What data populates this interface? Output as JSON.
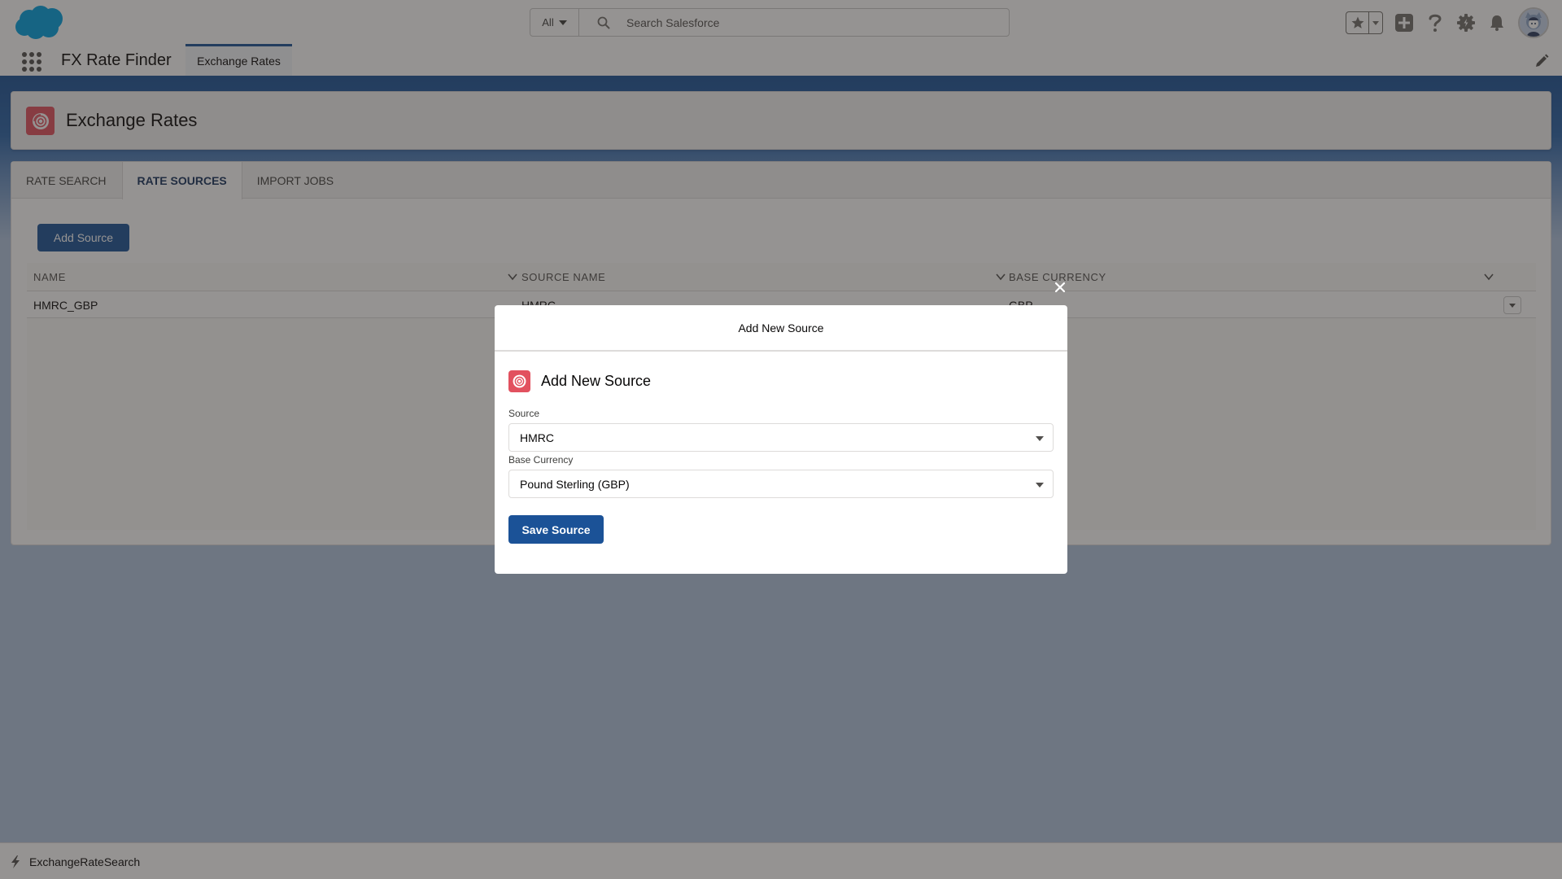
{
  "global_header": {
    "search_scope": "All",
    "search_placeholder": "Search Salesforce",
    "icons": [
      "salesforce-cloud-logo",
      "favorites-star-icon",
      "favorites-menu-caret",
      "global-create-icon",
      "help-icon",
      "setup-gear-icon",
      "notifications-bell-icon",
      "user-avatar"
    ]
  },
  "context_nav": {
    "app_name": "FX Rate Finder",
    "active_tab": "Exchange Rates"
  },
  "page_header": {
    "title": "Exchange Rates",
    "icon": "record-icon"
  },
  "tabs": [
    {
      "label": "RATE SEARCH",
      "active": false
    },
    {
      "label": "RATE SOURCES",
      "active": true
    },
    {
      "label": "IMPORT JOBS",
      "active": false
    }
  ],
  "rate_sources": {
    "add_button_label": "Add Source",
    "columns": [
      "NAME",
      "SOURCE NAME",
      "BASE CURRENCY"
    ],
    "rows": [
      {
        "name": "HMRC_GBP",
        "source_name": "HMRC",
        "base_currency": "GBP"
      }
    ]
  },
  "modal": {
    "header_title": "Add New Source",
    "card_title": "Add New Source",
    "fields": [
      {
        "label": "Source",
        "value": "HMRC"
      },
      {
        "label": "Base Currency",
        "value": "Pound Sterling (GBP)"
      }
    ],
    "save_label": "Save Source"
  },
  "utility_bar": {
    "item_label": "ExchangeRateSearch"
  },
  "colors": {
    "brand": "#1b5297",
    "record_icon": "#e2515f"
  }
}
